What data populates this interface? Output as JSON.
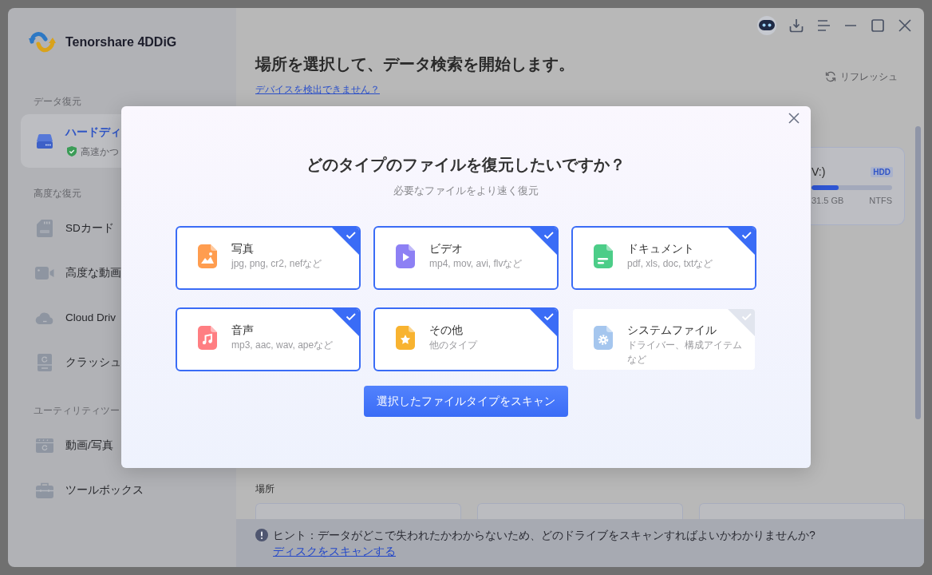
{
  "app": {
    "name": "Tenorshare 4DDiG"
  },
  "sidebar": {
    "sections": [
      {
        "label": "データ復元",
        "items": [
          {
            "kind": "drive",
            "label": "ハードディ",
            "note": "高速かつ",
            "selected": true
          }
        ]
      },
      {
        "label": "高度な復元",
        "items": [
          {
            "kind": "sd",
            "label": "SDカード",
            "selected": false
          },
          {
            "kind": "camera",
            "label": "高度な動画",
            "selected": false
          },
          {
            "kind": "cloud",
            "label": "Cloud Driv",
            "selected": false
          },
          {
            "kind": "crash",
            "label": "クラッシュ",
            "selected": false
          }
        ]
      },
      {
        "label": "ユーティリティツー",
        "items": [
          {
            "kind": "repair",
            "label": "動画/写真",
            "selected": false
          },
          {
            "kind": "toolbox",
            "label": "ツールボックス",
            "selected": false
          }
        ]
      }
    ]
  },
  "main": {
    "title": "場所を選択して、データ検索を開始します。",
    "help_link": "デバイスを検出できません？",
    "refresh": "リフレッシュ",
    "drive_card": {
      "name": "V:)",
      "badge": "HDD",
      "level": 0.34,
      "used": "31.5 GB",
      "file_system": "NTFS"
    },
    "locations": {
      "label": "場所"
    }
  },
  "hint": {
    "text": "ヒント：データがどこで失われたかわからないため、どのドライブをスキャンすればよいかわかりませんか?",
    "link": "ディスクをスキャンする"
  },
  "dialog": {
    "title": "どのタイプのファイルを復元したいですか？",
    "subtitle": "必要なファイルをより速く復元",
    "file_types": [
      {
        "kind": "photo",
        "title": "写真",
        "description": "jpg, png, cr2, nefなど",
        "selected": true
      },
      {
        "kind": "video",
        "title": "ビデオ",
        "description": "mp4, mov, avi, flvなど",
        "selected": true
      },
      {
        "kind": "document",
        "title": "ドキュメント",
        "description": "pdf, xls, doc, txtなど",
        "selected": true
      },
      {
        "kind": "audio",
        "title": "音声",
        "description": "mp3, aac, wav, apeなど",
        "selected": true
      },
      {
        "kind": "other",
        "title": "その他",
        "description": "他のタイプ",
        "selected": true
      },
      {
        "kind": "system",
        "title": "システムファイル",
        "description": "ドライバー、構成アイテムなど",
        "selected": false
      }
    ],
    "scan_button": "選択したファイルタイプをスキャン"
  }
}
